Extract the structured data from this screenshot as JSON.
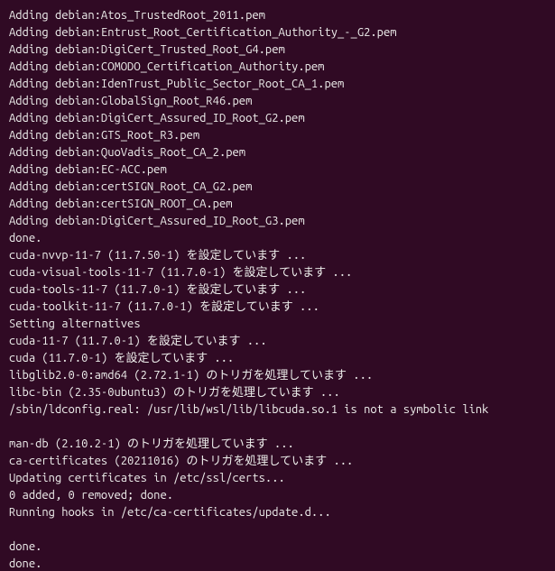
{
  "terminal": {
    "lines": [
      "Adding debian:Atos_TrustedRoot_2011.pem",
      "Adding debian:Entrust_Root_Certification_Authority_-_G2.pem",
      "Adding debian:DigiCert_Trusted_Root_G4.pem",
      "Adding debian:COMODO_Certification_Authority.pem",
      "Adding debian:IdenTrust_Public_Sector_Root_CA_1.pem",
      "Adding debian:GlobalSign_Root_R46.pem",
      "Adding debian:DigiCert_Assured_ID_Root_G2.pem",
      "Adding debian:GTS_Root_R3.pem",
      "Adding debian:QuoVadis_Root_CA_2.pem",
      "Adding debian:EC-ACC.pem",
      "Adding debian:certSIGN_Root_CA_G2.pem",
      "Adding debian:certSIGN_ROOT_CA.pem",
      "Adding debian:DigiCert_Assured_ID_Root_G3.pem",
      "done.",
      "cuda-nvvp-11-7 (11.7.50-1) を設定しています ...",
      "cuda-visual-tools-11-7 (11.7.0-1) を設定しています ...",
      "cuda-tools-11-7 (11.7.0-1) を設定しています ...",
      "cuda-toolkit-11-7 (11.7.0-1) を設定しています ...",
      "Setting alternatives",
      "cuda-11-7 (11.7.0-1) を設定しています ...",
      "cuda (11.7.0-1) を設定しています ...",
      "libglib2.0-0:amd64 (2.72.1-1) のトリガを処理しています ...",
      "libc-bin (2.35-0ubuntu3) のトリガを処理しています ...",
      "/sbin/ldconfig.real: /usr/lib/wsl/lib/libcuda.so.1 is not a symbolic link",
      "",
      "man-db (2.10.2-1) のトリガを処理しています ...",
      "ca-certificates (20211016) のトリガを処理しています ...",
      "Updating certificates in /etc/ssl/certs...",
      "0 added, 0 removed; done.",
      "Running hooks in /etc/ca-certificates/update.d...",
      "",
      "done.",
      "done."
    ]
  }
}
